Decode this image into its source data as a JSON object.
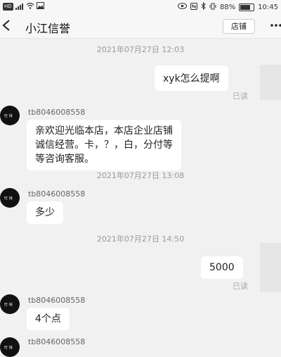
{
  "status_bar": {
    "left_icons": [
      "hd-icon",
      "signal-icon",
      "wifi-icon",
      "image-icon"
    ],
    "right_icons": [
      "eye-icon",
      "nfc-icon",
      "bluetooth-icon",
      "vibrate-icon"
    ],
    "battery": "88%",
    "battery_level": 0.88,
    "time": "10:45"
  },
  "header": {
    "back_icon": "back-arrow-icon",
    "title": "小江信誉",
    "shop_button": "店铺",
    "more_icon": "more-icon"
  },
  "messages": [
    {
      "type": "timestamp",
      "text": "2021年07月27日 12:03"
    },
    {
      "type": "sent",
      "text": "xyk怎么提啊",
      "status": "已读"
    },
    {
      "type": "received",
      "sender": "tb8046008558",
      "lines": [
        "亲欢迎光临本店，本店企业店铺",
        "诚信经营。卡，？，白，分付等",
        "等咨询客服。"
      ]
    },
    {
      "type": "timestamp",
      "text": "2021年07月27日 13:08"
    },
    {
      "type": "received",
      "sender": "tb8046008558",
      "lines": [
        "多少"
      ]
    },
    {
      "type": "timestamp",
      "text": "2021年07月27日 14:50"
    },
    {
      "type": "sent",
      "text": "5000",
      "status": "已读"
    },
    {
      "type": "received",
      "sender": "tb8046008558",
      "lines": [
        "4个点"
      ]
    },
    {
      "type": "received_partial",
      "sender": "tb8046008558"
    }
  ]
}
